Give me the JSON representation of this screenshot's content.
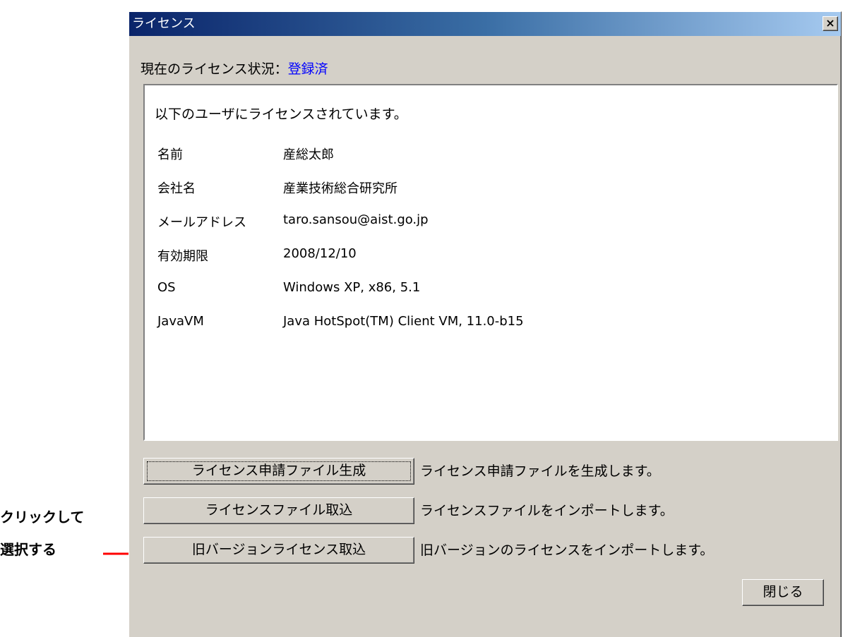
{
  "callout": {
    "line1": "クリックして",
    "line2": "選択する",
    "arrow_color": "#ff0000"
  },
  "window": {
    "title": "ライセンス",
    "close_glyph": "×"
  },
  "status": {
    "label": "現在のライセンス状況：",
    "value": "登録済",
    "value_color": "#0000ff"
  },
  "info": {
    "intro": "以下のユーザにライセンスされています。",
    "rows": [
      {
        "label": "名前",
        "value": "産総太郎"
      },
      {
        "label": "会社名",
        "value": "産業技術総合研究所"
      },
      {
        "label": "メールアドレス",
        "value": "taro.sansou@aist.go.jp"
      },
      {
        "label": "有効期限",
        "value": "2008/12/10"
      },
      {
        "label": "OS",
        "value": "Windows XP, x86, 5.1"
      },
      {
        "label": "JavaVM",
        "value": "Java HotSpot(TM) Client VM, 11.0-b15"
      }
    ]
  },
  "actions": [
    {
      "button": "ライセンス申請ファイル生成",
      "description": "ライセンス申請ファイルを生成します。"
    },
    {
      "button": "ライセンスファイル取込",
      "description": "ライセンスファイルをインポートします。"
    },
    {
      "button": "旧バージョンライセンス取込",
      "description": "旧バージョンのライセンスをインポートします。"
    }
  ],
  "footer": {
    "close_label": "閉じる"
  }
}
